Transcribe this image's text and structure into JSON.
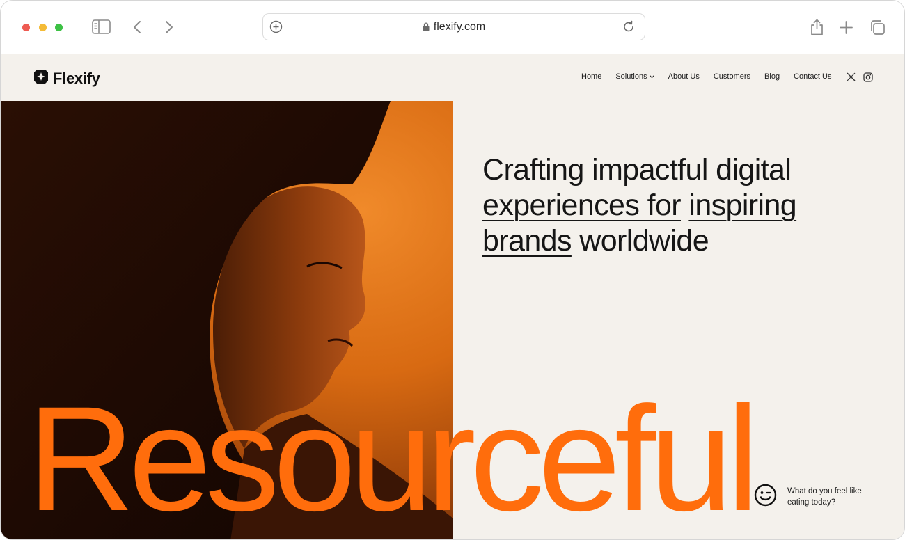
{
  "browser": {
    "url": "flexify.com"
  },
  "site": {
    "logo_text": "Flexify",
    "nav": [
      {
        "label": "Home",
        "has_dropdown": false
      },
      {
        "label": "Solutions",
        "has_dropdown": true
      },
      {
        "label": "About Us",
        "has_dropdown": false
      },
      {
        "label": "Customers",
        "has_dropdown": false
      },
      {
        "label": "Blog",
        "has_dropdown": false
      },
      {
        "label": "Contact Us",
        "has_dropdown": false
      }
    ],
    "social_icons": [
      "x-icon",
      "instagram-icon"
    ]
  },
  "hero": {
    "headline_part1": "Crafting impactful digital ",
    "headline_underlined_1": "experiences for",
    "headline_underlined_2": "inspiring brands",
    "headline_part2": "worldwide",
    "big_word": "Resourceful",
    "big_word_color": "#ff6d0c",
    "photo_tint": "#e07418"
  },
  "chat_widget": {
    "icon": "smiley-icon",
    "prompt": "What do you feel like eating today?"
  }
}
